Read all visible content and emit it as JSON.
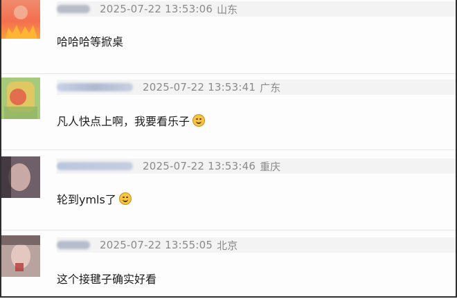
{
  "comments": [
    {
      "time": "2025-07-22 13:53:06",
      "location": "山东",
      "text": "哈哈哈等掀桌",
      "emoji": ""
    },
    {
      "time": "2025-07-22 13:53:41",
      "location": "广东",
      "text": "凡人快点上啊，我要看乐子",
      "emoji": "smile-emoji"
    },
    {
      "time": "2025-07-22 13:53:46",
      "location": "重庆",
      "text": "轮到ymls了",
      "emoji": "laugh-emoji"
    },
    {
      "time": "2025-07-22 13:55:05",
      "location": "北京",
      "text": "这个接毽子确实好看",
      "emoji": ""
    }
  ]
}
